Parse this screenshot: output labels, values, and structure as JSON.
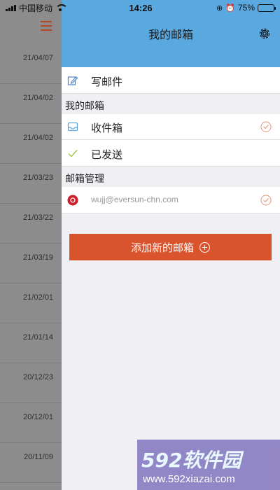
{
  "status_bar": {
    "carrier": "中国移动",
    "time": "14:26",
    "battery_percent": "75%",
    "battery_level": 0.75
  },
  "background_list": {
    "dates": [
      "21/04/07",
      "21/04/02",
      "21/04/02",
      "21/03/23",
      "21/03/22",
      "21/03/19",
      "21/02/01",
      "21/01/14",
      "20/12/23",
      "20/12/01",
      "20/11/09"
    ]
  },
  "drawer": {
    "title": "我的邮箱",
    "compose_label": "写邮件",
    "section_my_mailbox": "我的邮箱",
    "inbox_label": "收件箱",
    "sent_label": "已发送",
    "section_mailbox_management": "邮箱管理",
    "account_email": "wujj@eversun-chn.com",
    "add_mailbox_button": "添加新的邮箱"
  },
  "watermark": {
    "brand": "592软件园",
    "url": "www.592xiazai.com"
  },
  "colors": {
    "header_blue": "#5aa8e0",
    "accent_orange": "#d9532c"
  }
}
